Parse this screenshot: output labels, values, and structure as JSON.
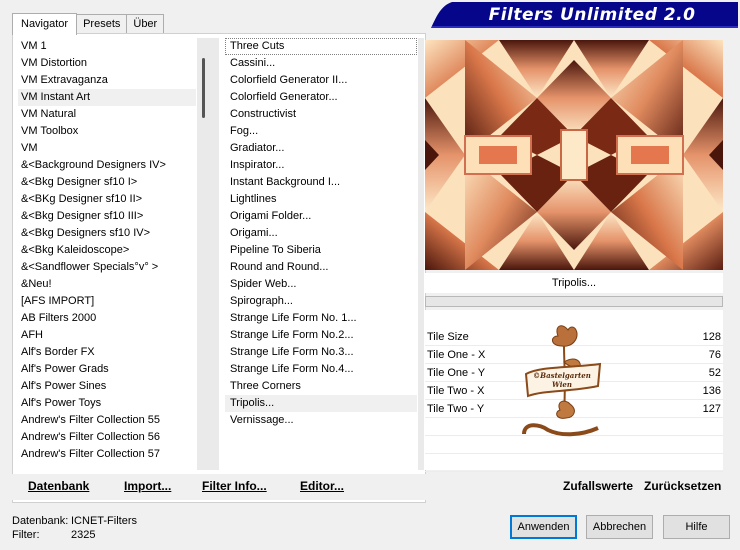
{
  "banner": {
    "title": "Filters Unlimited 2.0"
  },
  "tabs": [
    {
      "label": "Navigator",
      "active": true
    },
    {
      "label": "Presets",
      "active": false
    },
    {
      "label": "Über",
      "active": false
    }
  ],
  "categories": [
    "VM 1",
    "VM Distortion",
    "VM Extravaganza",
    "VM Instant Art",
    "VM Natural",
    "VM Toolbox",
    "VM",
    "&<Background Designers IV>",
    "&<Bkg Designer sf10 I>",
    "&<BKg Designer sf10 II>",
    "&<Bkg Designer sf10 III>",
    "&<Bkg Designers sf10 IV>",
    "&<Bkg Kaleidoscope>",
    "&<Sandflower Specials°v° >",
    "&Neu!",
    "[AFS IMPORT]",
    "AB Filters 2000",
    "AFH",
    "Alf's Border FX",
    "Alf's Power Grads",
    "Alf's Power Sines",
    "Alf's Power Toys",
    "Andrew's Filter Collection 55",
    "Andrew's Filter Collection 56",
    "Andrew's Filter Collection 57"
  ],
  "selected_category": "VM Instant Art",
  "filters": [
    "Three Cuts",
    "Cassini...",
    "Colorfield Generator II...",
    "Colorfield Generator...",
    "Constructivist",
    "Fog...",
    "Gradiator...",
    "Inspirator...",
    "Instant Background I...",
    "Lightlines",
    "Origami Folder...",
    "Origami...",
    "Pipeline To Siberia",
    "Round and Round...",
    "Spider Web...",
    "Spirograph...",
    "Strange Life Form No. 1...",
    "Strange Life Form No.2...",
    "Strange Life Form No.3...",
    "Strange Life Form No.4...",
    "Three Corners",
    "Tripolis...",
    "Vernissage..."
  ],
  "selected_filter": "Tripolis...",
  "left_toolbar": {
    "datenbank": "Datenbank",
    "import": "Import...",
    "filter_info": "Filter Info...",
    "editor": "Editor..."
  },
  "preview": {
    "filter_name": "Tripolis...",
    "progress": 0
  },
  "params": [
    {
      "label": "Tile Size",
      "value": "128"
    },
    {
      "label": "Tile One - X",
      "value": "76"
    },
    {
      "label": "Tile One - Y",
      "value": "52"
    },
    {
      "label": "Tile Two - X",
      "value": "136"
    },
    {
      "label": "Tile Two - Y",
      "value": "127"
    }
  ],
  "right_toolbar": {
    "random": "Zufallswerte",
    "reset": "Zurücksetzen"
  },
  "status": {
    "db_label": "Datenbank:",
    "db_value": "ICNET-Filters",
    "filter_label": "Filter:",
    "filter_value": "2325"
  },
  "buttons": {
    "apply": "Anwenden",
    "cancel": "Abbrechen",
    "help": "Hilfe"
  },
  "logo_text": {
    "line1": "©Bastelgarten",
    "line2": "Wien"
  },
  "colors": {
    "banner": "#06068a",
    "accent": "#0078d7"
  }
}
